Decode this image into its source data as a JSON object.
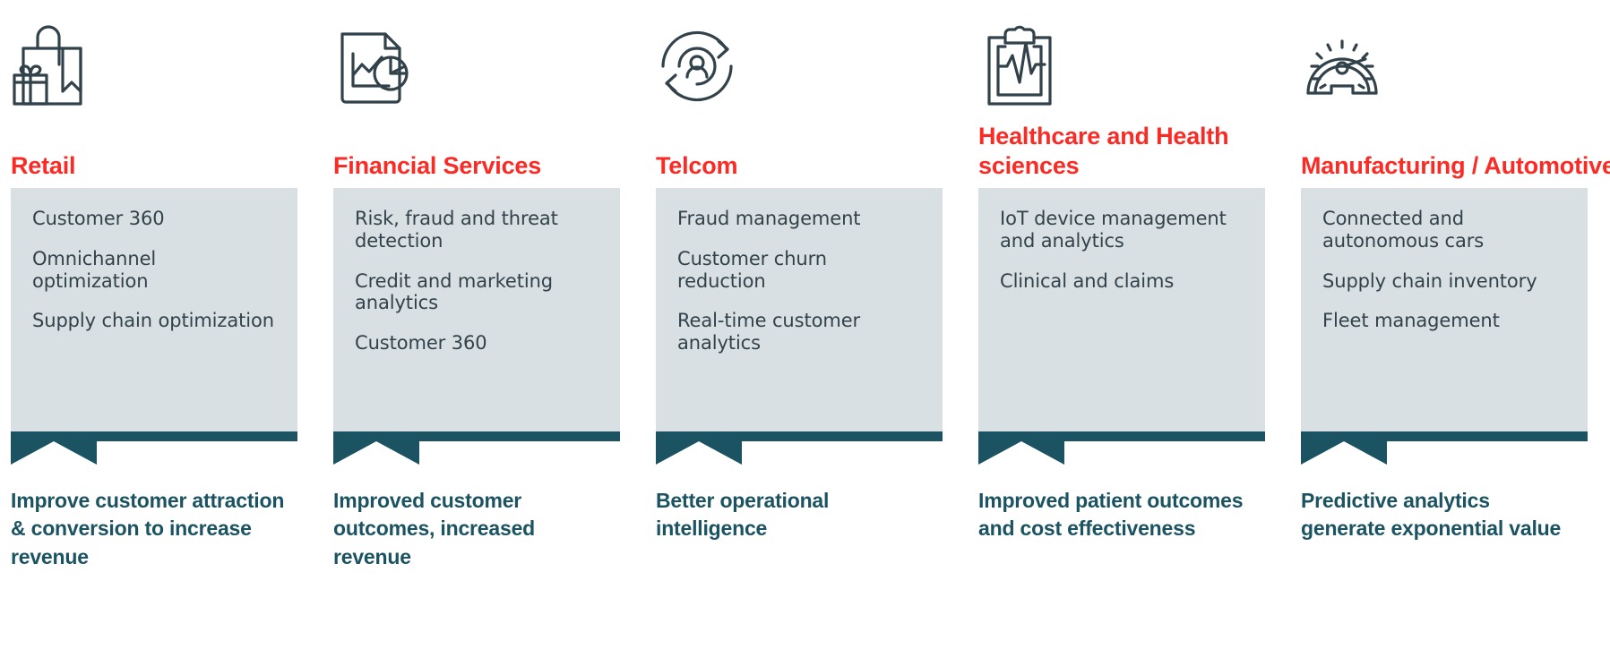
{
  "theme": {
    "accent_red": "#fa2b25",
    "box_fill": "#d9e0e3",
    "teal": "#1b5362",
    "body_text": "#32424b",
    "background": "#ffffff"
  },
  "columns": [
    {
      "icon": "shopping-bag-gift-icon",
      "title": "Retail",
      "items": [
        "Customer 360",
        "Omnichannel optimization",
        "Supply chain optimization"
      ],
      "outcome": "Improve customer attraction & conversion to increase revenue"
    },
    {
      "icon": "document-chart-pie-icon",
      "title": "Financial Services",
      "items": [
        "Risk, fraud and threat detection",
        "Credit and marketing analytics",
        "Customer 360"
      ],
      "outcome": "Improved customer outcomes, increased revenue"
    },
    {
      "icon": "customer-cycle-icon",
      "title": "Telcom",
      "items": [
        "Fraud management",
        "Customer churn reduction",
        "Real-time customer analytics"
      ],
      "outcome": "Better operational intelligence"
    },
    {
      "icon": "clipboard-heartbeat-icon",
      "title": "Healthcare and Health sciences",
      "items": [
        "IoT device management and analytics",
        "Clinical and claims"
      ],
      "outcome": "Improved patient outcomes and cost effectiveness"
    },
    {
      "icon": "speedometer-gauge-icon",
      "title": "Manufacturing / Automotive",
      "items": [
        "Connected and autonomous cars",
        "Supply chain inventory",
        "Fleet management"
      ],
      "outcome": "Predictive analytics generate exponential value"
    }
  ]
}
